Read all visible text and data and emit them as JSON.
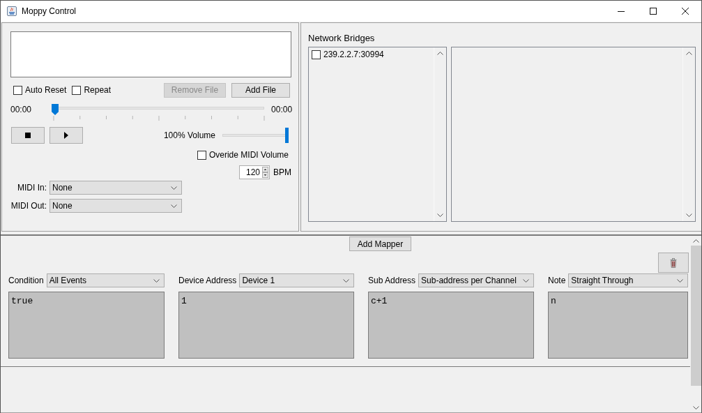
{
  "window": {
    "title": "Moppy Control"
  },
  "player": {
    "auto_reset": {
      "label": "Auto Reset",
      "checked": false
    },
    "repeat": {
      "label": "Repeat",
      "checked": false
    },
    "remove_file": {
      "label": "Remove File",
      "disabled": true
    },
    "add_file": {
      "label": "Add File",
      "disabled": false
    },
    "position": {
      "elapsed": "00:00",
      "total": "00:00",
      "level": 0
    },
    "volume": {
      "label": "100% Volume",
      "level": 1
    },
    "override_volume": {
      "label": "Overide MIDI Volume",
      "checked": false
    },
    "tempo": {
      "value": "120",
      "unit": "BPM"
    },
    "midi_in": {
      "label": "MIDI In:",
      "value": "None"
    },
    "midi_out": {
      "label": "MIDI Out:",
      "value": "None"
    }
  },
  "network_bridges": {
    "title": "Network Bridges",
    "items": [
      {
        "label": "239.2.2.7:30994",
        "checked": false
      }
    ]
  },
  "mappers": {
    "add_button": "Add Mapper",
    "fields": [
      {
        "label": "Condition",
        "selection": "All Events",
        "script": "true"
      },
      {
        "label": "Device Address",
        "selection": "Device 1",
        "script": "1"
      },
      {
        "label": "Sub Address",
        "selection": "Sub-address per Channel",
        "script": "c+1"
      },
      {
        "label": "Note",
        "selection": "Straight Through",
        "script": "n"
      }
    ]
  }
}
